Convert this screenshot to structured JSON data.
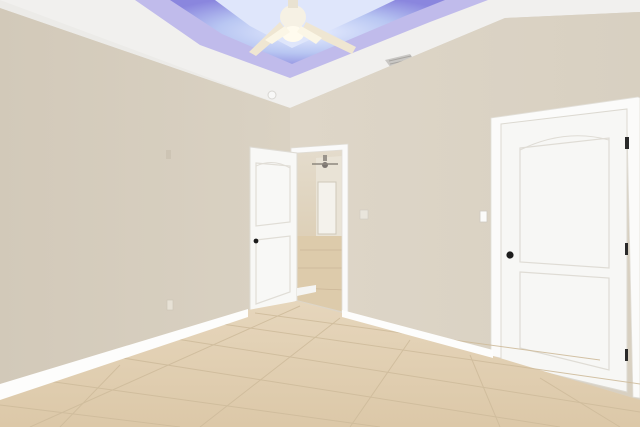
{
  "scene": {
    "kind": "empty-bedroom-interior",
    "colors": {
      "ceiling": "#f2f1ef",
      "tray_glow": "#8f8fe6",
      "tray_light": "#c9d6f6",
      "wall_left": "#d6cebf",
      "wall_back": "#dcd4c5",
      "floor": "#e2d0b4",
      "floor_grout": "#cdb99a",
      "trim": "#ffffff",
      "door": "#f7f7f4"
    },
    "objects": [
      "ceiling-fan-icon",
      "tray-ceiling-light",
      "air-vent",
      "smoke-detector",
      "open-interior-door",
      "hallway-opening",
      "closet-door",
      "light-switch",
      "baseboard",
      "tile-floor"
    ]
  }
}
